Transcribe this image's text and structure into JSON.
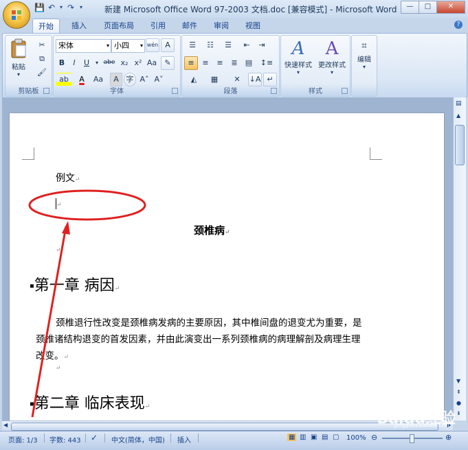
{
  "window": {
    "title": "新建 Microsoft Office Word 97-2003 文档.doc [兼容模式] - Microsoft Word"
  },
  "quick_access": {
    "save_icon": "save-icon",
    "undo_icon": "undo-icon",
    "redo_icon": "redo-icon"
  },
  "tabs": [
    "开始",
    "插入",
    "页面布局",
    "引用",
    "邮件",
    "审阅",
    "视图"
  ],
  "ribbon": {
    "clipboard": {
      "label": "剪贴板",
      "paste": "粘贴"
    },
    "font": {
      "label": "字体",
      "font_name": "宋体",
      "font_size": "小四",
      "buttons": [
        "B",
        "I",
        "U",
        "abe",
        "x₂",
        "x²",
        "Aa",
        "A",
        "A",
        "A"
      ]
    },
    "paragraph": {
      "label": "段落"
    },
    "styles": {
      "label": "样式",
      "quick_styles": "快速样式",
      "change_styles": "更改样式"
    },
    "editing": {
      "label": "编辑"
    }
  },
  "document": {
    "line1": "例文",
    "title": "颈椎病",
    "heading1": "第一章  病因",
    "para1_line1": "颈椎退行性改变是颈椎病发病的主要原因，其中椎间盘的退变尤为重要，是",
    "para1_line2": "颈椎诸结构退变的首发因素，并由此演变出一系列颈椎病的病理解剖及病理生理",
    "para1_line3": "改变。",
    "heading2": "第二章  临床表现"
  },
  "status_bar": {
    "page": "页面: 1/3",
    "words": "字数: 443",
    "language": "中文(简体，中国)",
    "mode": "插入",
    "zoom": "100%"
  },
  "watermark": {
    "brand": "Baidu经验",
    "site": "jingyan.baidu.com"
  },
  "colors": {
    "annotation": "#e02020"
  }
}
